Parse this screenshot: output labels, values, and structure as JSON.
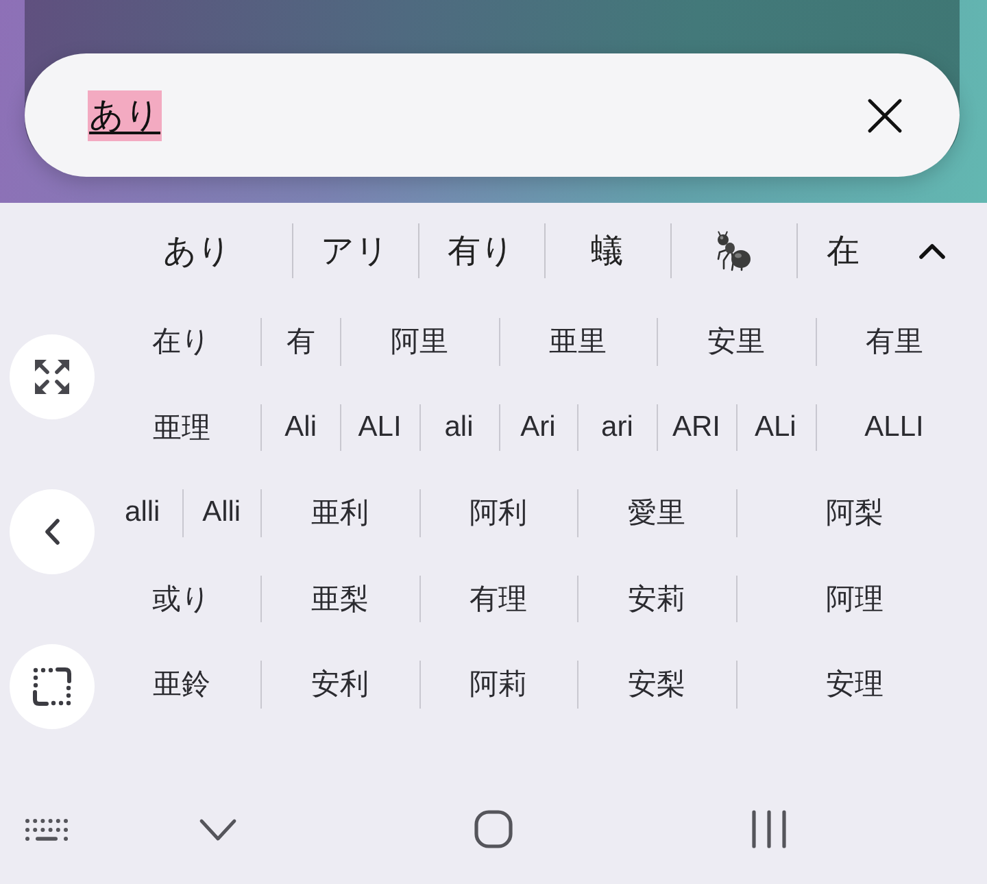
{
  "search": {
    "value": "あり",
    "composing": true
  },
  "suggestion_bar": {
    "candidates": [
      {
        "kind": "text",
        "text": "あり"
      },
      {
        "kind": "text",
        "text": "アリ"
      },
      {
        "kind": "text",
        "text": "有り"
      },
      {
        "kind": "text",
        "text": "蟻"
      },
      {
        "kind": "emoji"
      },
      {
        "kind": "text",
        "text": "在"
      }
    ],
    "expanded": true
  },
  "side_buttons": [
    {
      "kind": "resize"
    },
    {
      "kind": "back"
    },
    {
      "kind": "select"
    }
  ],
  "candidate_grid": {
    "rows": [
      [
        "在り",
        "有",
        "阿里",
        "亜里",
        "安里",
        "有里"
      ],
      [
        "亜理",
        "Ali",
        "ALI",
        "ali",
        "Ari",
        "ari",
        "ARI",
        "ALi",
        "ALLI"
      ],
      [
        "alli",
        "Alli",
        "亜利",
        "阿利",
        "愛里",
        "阿梨"
      ],
      [
        "或り",
        "亜梨",
        "有理",
        "安莉",
        "阿理"
      ],
      [
        "亜鈴",
        "安利",
        "阿莉",
        "安梨",
        "安理"
      ]
    ]
  },
  "nav_bar": [
    {
      "kind": "keyboard"
    },
    {
      "kind": "hide"
    },
    {
      "kind": "home"
    },
    {
      "kind": "recents"
    }
  ]
}
